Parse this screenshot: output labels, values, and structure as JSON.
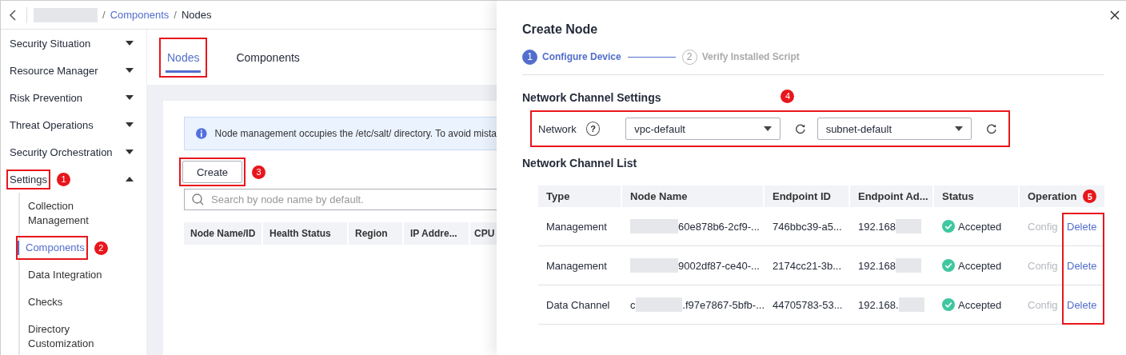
{
  "breadcrumb": [
    {
      "separator": "/",
      "text": "Components",
      "link": true
    },
    {
      "separator": "/",
      "text": "Nodes",
      "link": false
    }
  ],
  "sidebar": {
    "items": [
      {
        "label": "Security Situation",
        "expanded": false
      },
      {
        "label": "Resource Manager",
        "expanded": false
      },
      {
        "label": "Risk Prevention",
        "expanded": false
      },
      {
        "label": "Threat Operations",
        "expanded": false
      },
      {
        "label": "Security Orchestration",
        "expanded": false
      },
      {
        "label": "Settings",
        "expanded": true,
        "highlighted": true,
        "callout": "1",
        "children": [
          {
            "label": "Collection Management",
            "selected": false
          },
          {
            "label": "Components",
            "selected": true,
            "highlighted": true,
            "callout": "2"
          },
          {
            "label": "Data Integration",
            "selected": false
          },
          {
            "label": "Checks",
            "selected": false
          },
          {
            "label": "Directory Customization",
            "selected": false
          }
        ]
      }
    ]
  },
  "tabs": [
    {
      "label": "Nodes",
      "selected": true,
      "highlighted": true
    },
    {
      "label": "Components",
      "selected": false,
      "highlighted": false
    }
  ],
  "notice": "Node management occupies the /etc/salt/ directory. To avoid mista",
  "create_button": {
    "label": "Create",
    "highlighted": true,
    "callout": "3"
  },
  "search": {
    "placeholder": "Search by node name by default."
  },
  "nodes_table": {
    "columns": [
      "Node Name/ID",
      "Health Status",
      "Region",
      "IP Addre...",
      "CPU"
    ]
  },
  "drawer": {
    "title": "Create Node",
    "steps": [
      {
        "number": "1",
        "label": "Configure Device",
        "selected": true
      },
      {
        "number": "2",
        "label": "Verify Installed Script",
        "selected": false
      }
    ],
    "settings_heading": "Network Channel Settings",
    "settings_callout": "4",
    "network": {
      "label": "Network",
      "help_icon": "?",
      "highlighted": true,
      "vpc": "vpc-default",
      "subnet": "subnet-default"
    },
    "list_heading": "Network Channel List",
    "channels": {
      "columns": [
        "Type",
        "Node Name",
        "Endpoint ID",
        "Endpoint Ad...",
        "Status",
        "Operation"
      ],
      "operation_callout": "5",
      "operation_highlighted": true,
      "rows": [
        {
          "type": "Management",
          "node_after": "60e878b6-2cf9-...",
          "endpoint_id": "746bbc39-a5...",
          "endpoint_address": "192.168",
          "status": "Accepted",
          "actions": [
            {
              "label": "Config",
              "disabled": true
            },
            {
              "label": "Delete",
              "disabled": false
            }
          ]
        },
        {
          "type": "Management",
          "node_after": "9002df87-ce40-...",
          "endpoint_id": "2174cc21-3b...",
          "endpoint_address": "192.168",
          "status": "Accepted",
          "actions": [
            {
              "label": "Config",
              "disabled": true
            },
            {
              "label": "Delete",
              "disabled": false
            }
          ]
        },
        {
          "type": "Data Channel",
          "node_before": "c",
          "node_after": ".f97e7867-5bfb-...",
          "endpoint_id": "44705783-53...",
          "endpoint_address": "192.168.",
          "status": "Accepted",
          "actions": [
            {
              "label": "Config",
              "disabled": true
            },
            {
              "label": "Delete",
              "disabled": false
            }
          ]
        }
      ]
    }
  }
}
